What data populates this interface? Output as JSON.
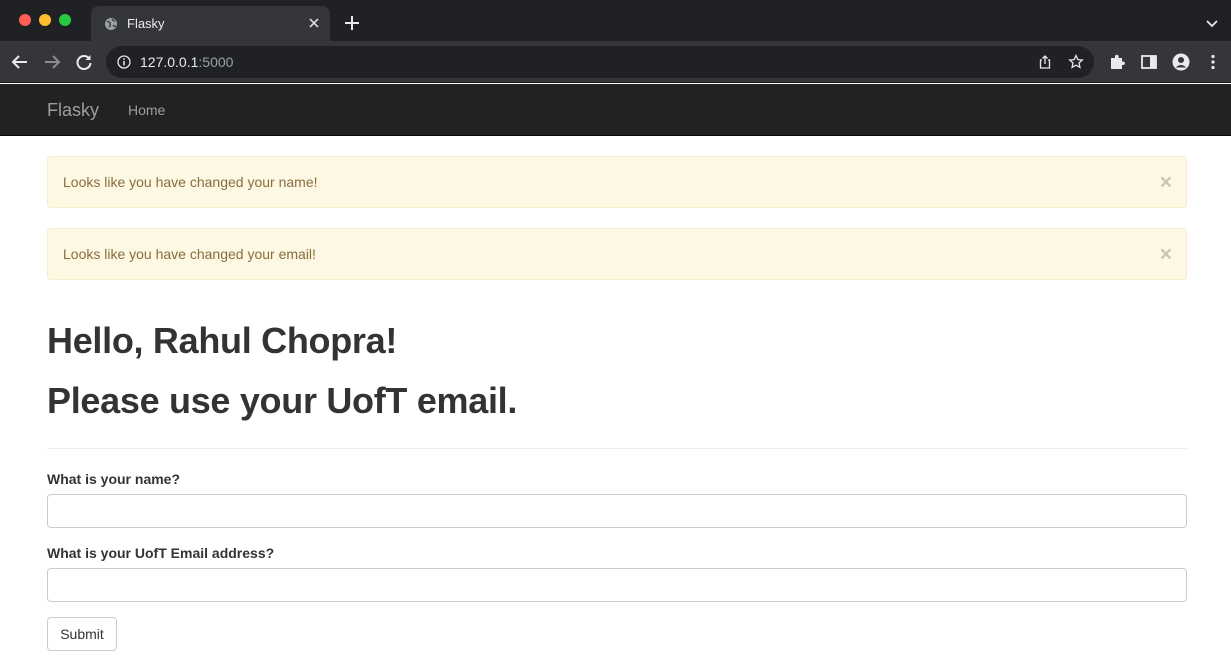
{
  "browser": {
    "tab_title": "Flasky",
    "url_host": "127.0.0.1",
    "url_port": ":5000"
  },
  "navbar": {
    "brand": "Flasky",
    "links": [
      "Home"
    ]
  },
  "alerts": [
    {
      "text": "Looks like you have changed your name!",
      "close": "×"
    },
    {
      "text": "Looks like you have changed your email!",
      "close": "×"
    }
  ],
  "headings": {
    "greeting": "Hello, Rahul Chopra!",
    "notice": "Please use your UofT email."
  },
  "form": {
    "name_label": "What is your name?",
    "name_value": "",
    "email_label": "What is your UofT Email address?",
    "email_value": "",
    "submit_label": "Submit"
  }
}
